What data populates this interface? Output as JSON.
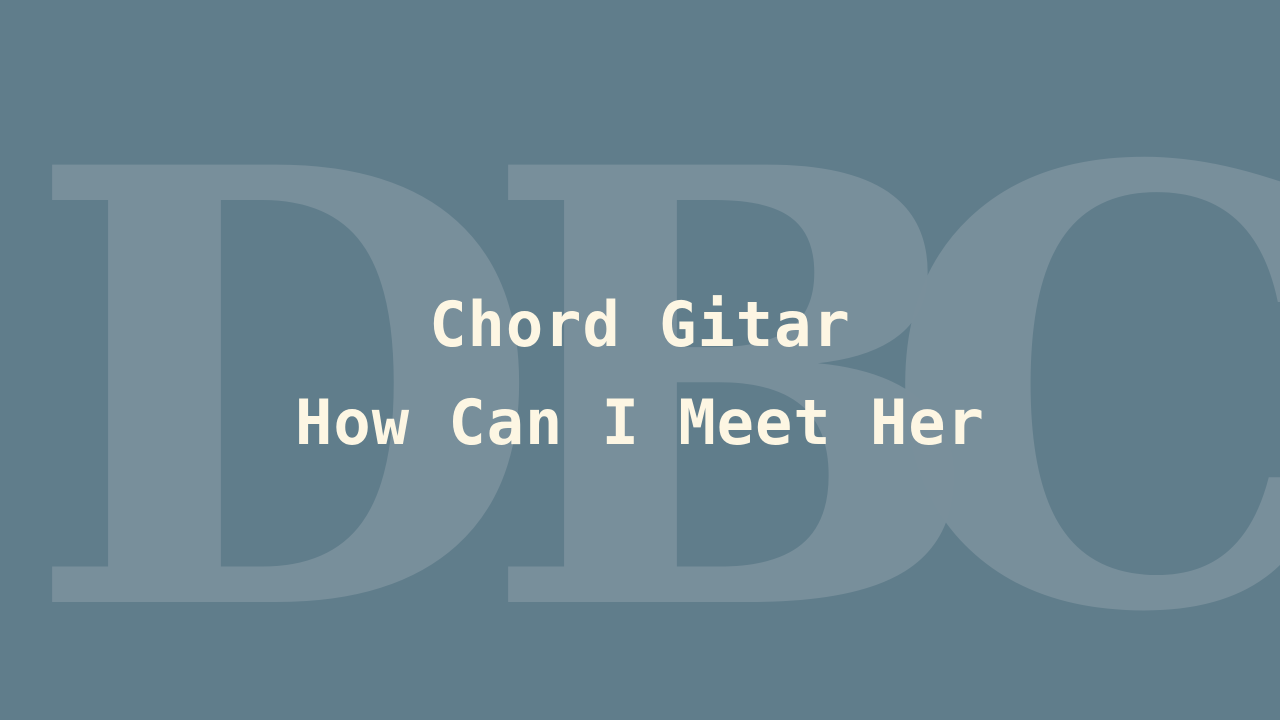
{
  "background_color": "#607d8b",
  "watermark": {
    "letters": [
      "D",
      "B",
      "C"
    ],
    "color": "#7a909c"
  },
  "title": {
    "line1": "Chord Gitar",
    "line2": "How Can I Meet Her",
    "color": "#fdf6e3"
  }
}
